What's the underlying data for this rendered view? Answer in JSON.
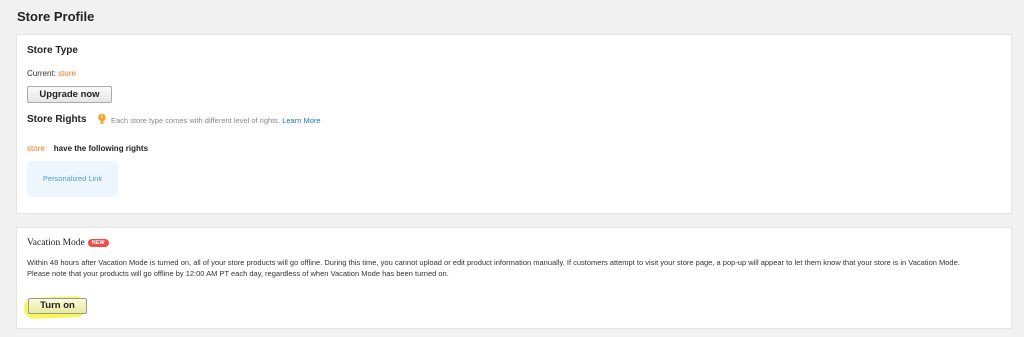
{
  "page": {
    "title": "Store Profile"
  },
  "store_type": {
    "title": "Store Type",
    "current_label": "Current:",
    "current_value": "store",
    "upgrade_label": "Upgrade now"
  },
  "store_rights": {
    "title": "Store Rights",
    "hint": "Each store type comes with different level of rights.",
    "learn_more": "Learn More",
    "store_name": "store",
    "rights_text": "have the following rights",
    "tiles": [
      "Personalized Link"
    ]
  },
  "vacation": {
    "title": "Vacation Mode",
    "badge": "NEW",
    "description": "Within 48 hours after Vacation Mode is turned on, all of your store products will go offline. During this time, you cannot upload or edit product information manually. If customers attempt to visit your store page, a pop-up will appear to let them know that your store is in Vacation Mode.",
    "note": "Please note that your products will go offline by 12:00 AM PT each day, regardless of when Vacation Mode has been turned on.",
    "button_label": "Turn on"
  },
  "colors": {
    "accent_orange": "#ef7a1f",
    "link_blue": "#1e73be",
    "badge_red": "#f04a4a",
    "highlight_yellow": "#f5f75a"
  }
}
